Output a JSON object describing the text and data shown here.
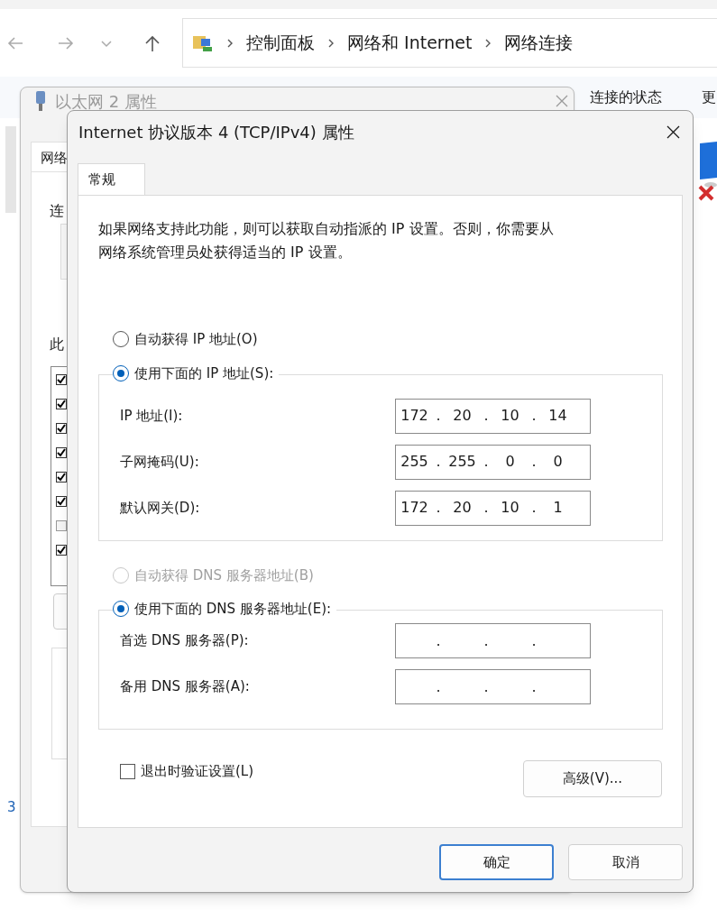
{
  "explorer": {
    "breadcrumbs": [
      "控制面板",
      "网络和 Internet",
      "网络连接"
    ],
    "command_bar": [
      "连接的状态",
      "更"
    ],
    "fragment": "3"
  },
  "back_window": {
    "title": "以太网 2 属性",
    "tab": "网络",
    "labels": [
      "连",
      "此"
    ],
    "items": [
      {
        "checked": true
      },
      {
        "checked": true
      },
      {
        "checked": true
      },
      {
        "checked": true
      },
      {
        "checked": true
      },
      {
        "checked": true
      },
      {
        "checked": false
      },
      {
        "checked": true
      }
    ]
  },
  "dialog": {
    "title": "Internet 协议版本 4 (TCP/IPv4) 属性",
    "tabs": [
      {
        "label": "常规",
        "selected": true
      }
    ],
    "description": "如果网络支持此功能，则可以获取自动指派的 IP 设置。否则，你需要从网络系统管理员处获得适当的 IP 设置。",
    "ip_auto": {
      "label": "自动获得 IP 地址(O)",
      "selected": false,
      "disabled": false
    },
    "ip_manual": {
      "label": "使用下面的 IP 地址(S):",
      "selected": true,
      "disabled": false
    },
    "ip_fields": [
      {
        "label": "IP 地址(I):",
        "separator": ".",
        "octets": [
          "172",
          "20",
          "10",
          "14"
        ]
      },
      {
        "label": "子网掩码(U):",
        "separator": ".",
        "octets": [
          "255",
          "255",
          "0",
          "0"
        ]
      },
      {
        "label": "默认网关(D):",
        "separator": ".",
        "octets": [
          "172",
          "20",
          "10",
          "1"
        ]
      }
    ],
    "dns_auto": {
      "label": "自动获得 DNS 服务器地址(B)",
      "selected": false,
      "disabled": true
    },
    "dns_manual": {
      "label": "使用下面的 DNS 服务器地址(E):",
      "selected": true,
      "disabled": false
    },
    "dns_fields": [
      {
        "label": "首选 DNS 服务器(P):",
        "separator": "."
      },
      {
        "label": "备用 DNS 服务器(A):",
        "separator": "."
      }
    ],
    "validate": {
      "label": "退出时验证设置(L)",
      "checked": false
    },
    "advanced_button": "高级(V)...",
    "buttons": [
      {
        "label": "确定",
        "kind": "default"
      },
      {
        "label": "取消",
        "kind": "normal"
      }
    ]
  }
}
